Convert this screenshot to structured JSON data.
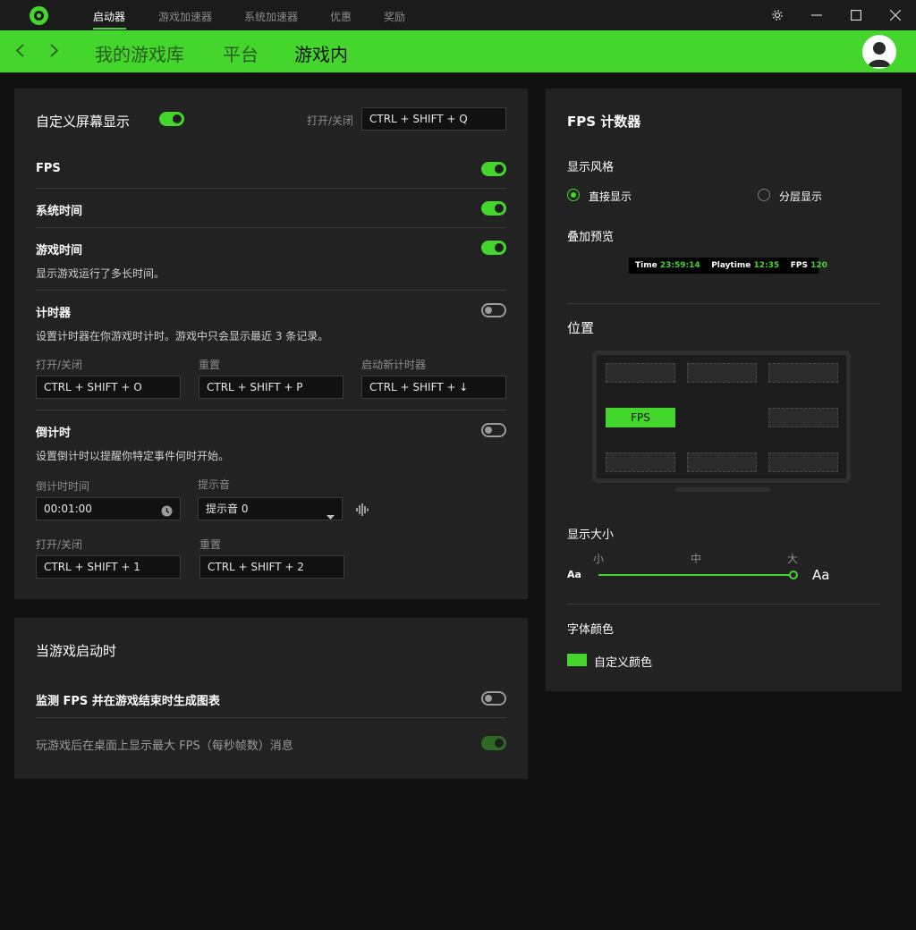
{
  "titlebar": {
    "tabs": [
      {
        "label": "启动器",
        "active": true
      },
      {
        "label": "游戏加速器",
        "active": false
      },
      {
        "label": "系统加速器",
        "active": false
      },
      {
        "label": "优惠",
        "active": false
      },
      {
        "label": "奖励",
        "active": false
      }
    ],
    "settings_icon": "gear-icon",
    "minimize_icon": "minimize-icon",
    "maximize_icon": "maximize-icon",
    "close_icon": "close-icon"
  },
  "navbar": {
    "back_icon": "chevron-left-icon",
    "forward_icon": "chevron-right-icon",
    "items": [
      {
        "label": "我的游戏库",
        "active": false
      },
      {
        "label": "平台",
        "active": false
      },
      {
        "label": "游戏内",
        "active": true
      }
    ],
    "avatar_icon": "user-avatar-icon"
  },
  "osd": {
    "title": "自定义屏幕显示",
    "enabled": true,
    "hotkey_label": "打开/关闭",
    "hotkey_value": "CTRL + SHIFT + Q",
    "fps": {
      "label": "FPS",
      "enabled": true
    },
    "system_time": {
      "label": "系统时间",
      "enabled": true
    },
    "game_time": {
      "label": "游戏时间",
      "enabled": true,
      "desc": "显示游戏运行了多长时间。"
    },
    "timer": {
      "label": "计时器",
      "enabled": false,
      "desc": "设置计时器在你游戏时计时。游戏中只会显示最近 3 条记录。",
      "toggle_label": "打开/关闭",
      "toggle_value": "CTRL + SHIFT + O",
      "reset_label": "重置",
      "reset_value": "CTRL + SHIFT + P",
      "new_label": "启动新计时器",
      "new_value": "CTRL + SHIFT + ↓"
    },
    "countdown": {
      "label": "倒计时",
      "enabled": false,
      "desc": "设置倒计时以提醒你特定事件何时开始。",
      "time_label": "倒计时时间",
      "time_value": "00:01:00",
      "sound_label": "提示音",
      "sound_value": "提示音 0",
      "toggle_label": "打开/关闭",
      "toggle_value": "CTRL + SHIFT + 1",
      "reset_label": "重置",
      "reset_value": "CTRL + SHIFT + 2"
    }
  },
  "game_launch": {
    "title": "当游戏启动时",
    "monitor_fps": {
      "label": "监测 FPS 并在游戏结束时生成图表",
      "enabled": false
    },
    "show_max_fps": {
      "label": "玩游戏后在桌面上显示最大 FPS（每秒帧数）消息",
      "enabled": true
    }
  },
  "fps_counter": {
    "title": "FPS 计数器",
    "style_label": "显示风格",
    "style_options": [
      {
        "label": "直接显示",
        "selected": true
      },
      {
        "label": "分层显示",
        "selected": false
      }
    ],
    "preview_label": "叠加预览",
    "preview": {
      "time_key": "Time",
      "time_val": "23:59:14",
      "playtime_key": "Playtime",
      "playtime_val": "12:35",
      "fps_key": "FPS",
      "fps_val": "120"
    },
    "position_label": "位置",
    "position_selected": "FPS",
    "size_label": "显示大小",
    "size_ticks": [
      "小",
      "中",
      "大"
    ],
    "size_value": "大",
    "size_small_sample": "Aa",
    "size_large_sample": "Aa",
    "color_label": "字体颜色",
    "color_option": "自定义颜色",
    "color_value": "#44d62c"
  }
}
